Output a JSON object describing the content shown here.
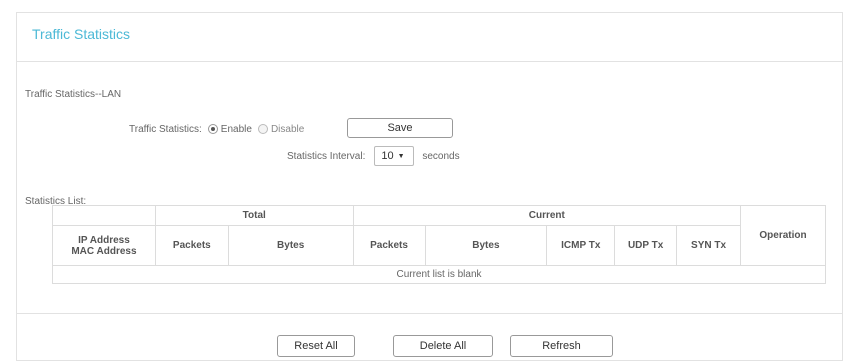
{
  "header": {
    "title": "Traffic Statistics"
  },
  "lan_section": {
    "title": "Traffic Statistics--LAN",
    "traffic_statistics_label": "Traffic Statistics:",
    "enable_label": "Enable",
    "disable_label": "Disable",
    "selected": "Enable",
    "save_label": "Save",
    "interval_label": "Statistics Interval:",
    "interval_value": "10",
    "interval_unit": "seconds"
  },
  "list_section": {
    "title": "Statistics List:",
    "group_headers": {
      "total": "Total",
      "current": "Current"
    },
    "columns": {
      "ip_address": "IP Address",
      "mac_address": "MAC Address",
      "packets": "Packets",
      "bytes": "Bytes",
      "current_packets": "Packets",
      "current_bytes": "Bytes",
      "icmp_tx": "ICMP Tx",
      "udp_tx": "UDP Tx",
      "syn_tx": "SYN Tx",
      "operation": "Operation"
    },
    "empty_message": "Current list is blank"
  },
  "footer": {
    "reset_all_label": "Reset All",
    "delete_all_label": "Delete All",
    "refresh_label": "Refresh"
  },
  "colors": {
    "accent": "#4cb9d6",
    "border": "#dcdcdc"
  }
}
